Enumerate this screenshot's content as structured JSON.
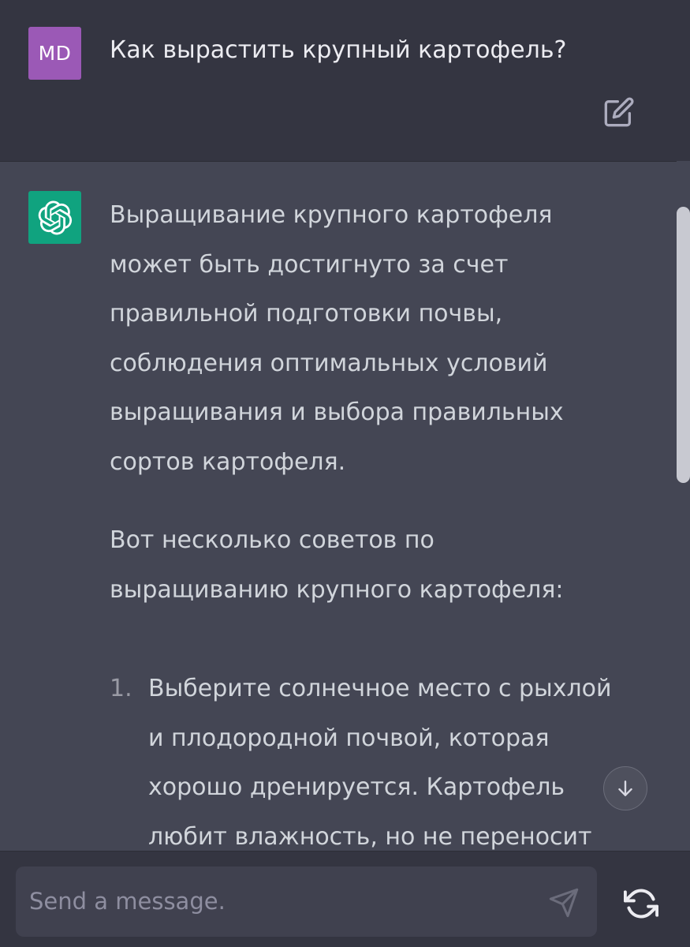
{
  "user_message": {
    "avatar_initials": "MD",
    "avatar_color": "#9b59b6",
    "text": "Как вырастить крупный картофель?",
    "edit_icon": "edit-icon"
  },
  "assistant_message": {
    "avatar_color": "#10a37f",
    "avatar_icon": "openai-logo-icon",
    "paragraph_1": "Выращивание крупного картофеля\nможет быть достигнуто за счет\nправильной подготовки почвы,\nсоблюдения оптимальных условий\nвыращивания и выбора правильных\nсортов картофеля.",
    "paragraph_2": "Вот несколько советов по\nвыращиванию крупного картофеля:",
    "list_items": [
      {
        "number": "1.",
        "text": "Выберите солнечное место с рыхлой\nи плодородной почвой, которая\nхорошо дренируется. Картофель\nлюбит влажность, но не переносит"
      }
    ]
  },
  "composer": {
    "placeholder": "Send a message.",
    "send_icon": "send-icon",
    "regenerate_icon": "refresh-icon"
  },
  "scroll_down_icon": "arrow-down-icon"
}
